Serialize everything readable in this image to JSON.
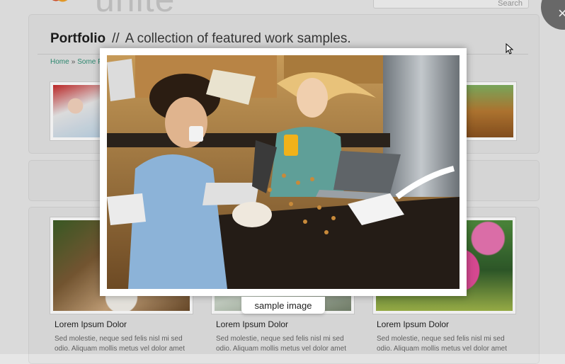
{
  "header": {
    "logo_text": "unite",
    "search_placeholder": "Search",
    "corner_button_label": "×"
  },
  "page": {
    "title": "Portfolio",
    "separator": "//",
    "subtitle": "A collection of featured work samples."
  },
  "breadcrumb": {
    "items": [
      "Home",
      "Some P"
    ],
    "separator": "»"
  },
  "portfolio_items": [
    {
      "title": "Lorem Ipsum Dolor",
      "text": "Sed molestie, neque sed felis nisl mi sed odio. Aliquam mollis metus vel dolor amet"
    },
    {
      "title": "Lorem Ipsum Dolor",
      "text": "Sed molestie, neque sed felis nisl mi sed odio. Aliquam mollis metus vel dolor amet"
    },
    {
      "title": "Lorem Ipsum Dolor",
      "text": "Sed molestie, neque sed felis nisl mi sed odio. Aliquam mollis metus vel dolor amet"
    }
  ],
  "lightbox": {
    "caption": "sample image"
  },
  "colors": {
    "link": "#2f8f75",
    "background": "#e8e8e8",
    "panel": "#e3e3e3"
  }
}
